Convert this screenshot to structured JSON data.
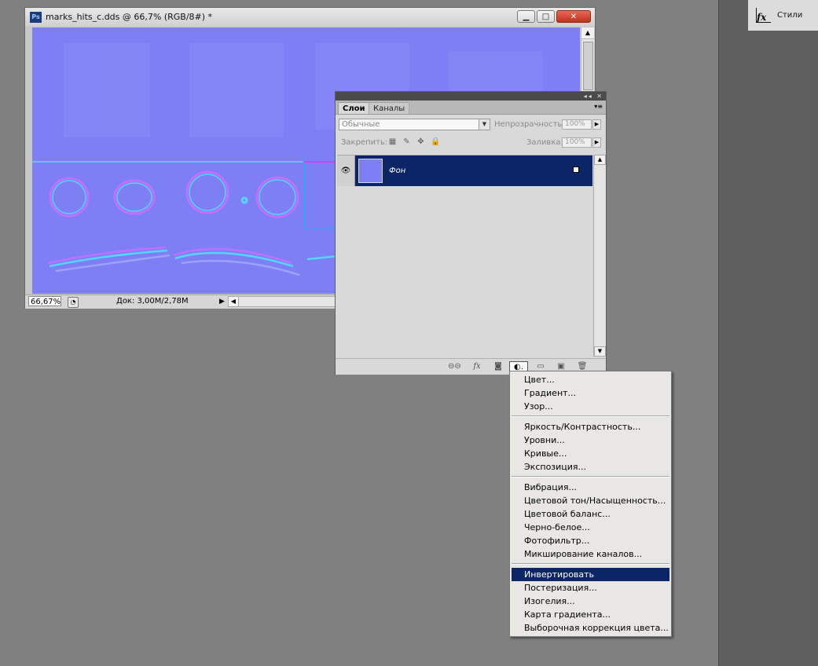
{
  "right_dock": {
    "styles_label": "Стили",
    "styles_icon": "fx-icon"
  },
  "document": {
    "title": "marks_hits_c.dds @ 66,7% (RGB/8#) *",
    "ps_badge": "Ps",
    "zoom": "66,67%",
    "doc_info": "Док: 3,00M/2,78M",
    "canvas_color": "#7f7ff5"
  },
  "layers_panel": {
    "tabs": [
      "Слои",
      "Каналы"
    ],
    "blend_mode": "Обычные",
    "opacity_label": "Непрозрачность:",
    "opacity_value": "100%",
    "lock_label": "Закрепить:",
    "fill_label": "Заливка:",
    "fill_value": "100%",
    "layer": {
      "name": "Фон",
      "selected": true
    }
  },
  "menu": {
    "groups": [
      [
        "Цвет...",
        "Градиент...",
        "Узор..."
      ],
      [
        "Яркость/Контрастность...",
        "Уровни...",
        "Кривые...",
        "Экспозиция..."
      ],
      [
        "Вибрация...",
        "Цветовой тон/Насыщенность...",
        "Цветовой баланс...",
        "Черно-белое...",
        "Фотофильтр...",
        "Микширование каналов..."
      ],
      [
        "Инвертировать",
        "Постеризация...",
        "Изогелия...",
        "Карта градиента...",
        "Выборочная коррекция цвета..."
      ]
    ],
    "highlighted": "Инвертировать",
    "highlight_color": "#0c2566"
  }
}
